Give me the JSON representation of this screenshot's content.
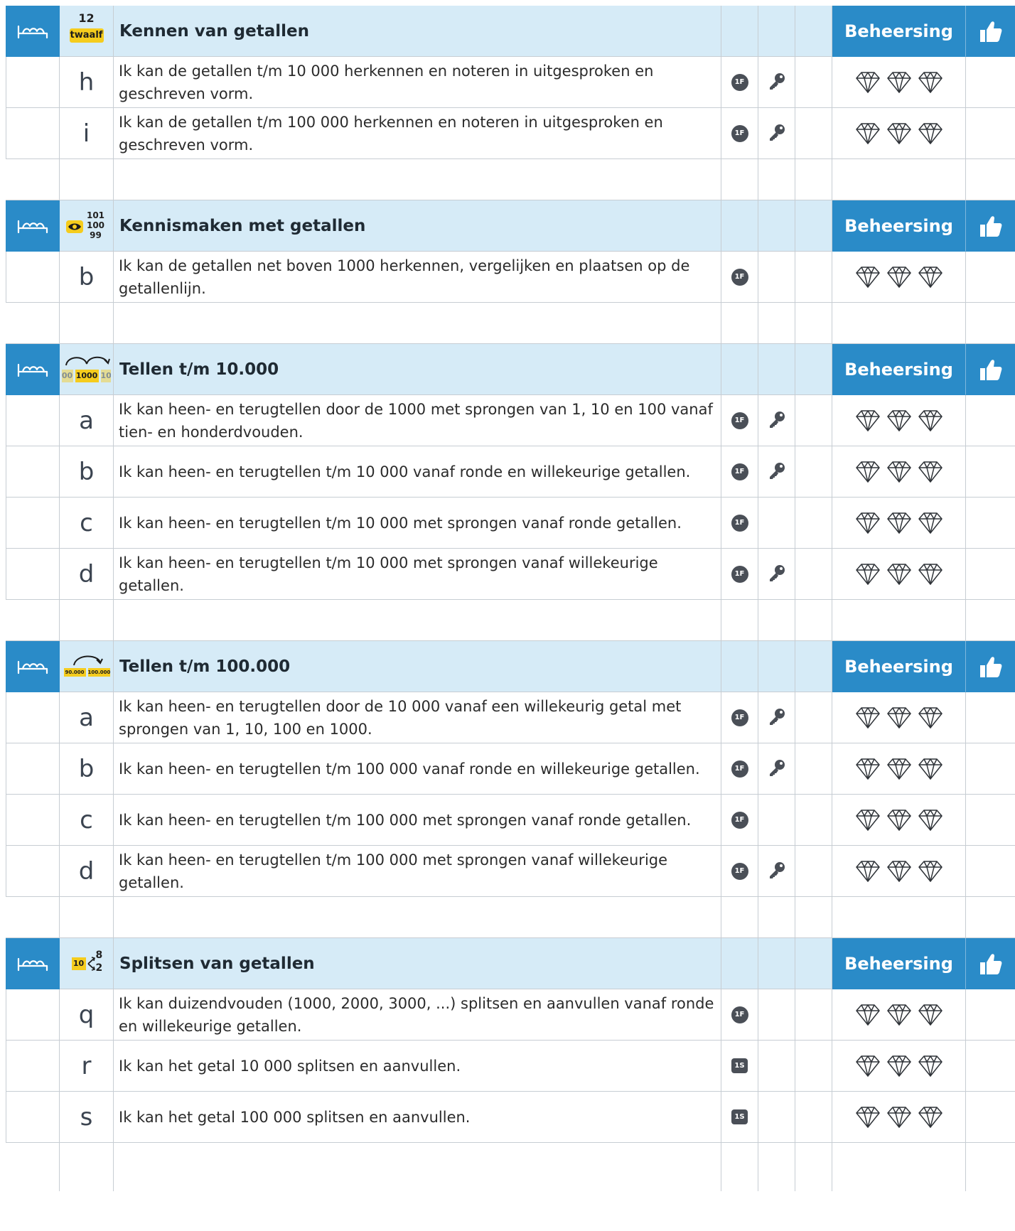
{
  "mastery_label": "Beheersing",
  "sections": [
    {
      "icon": "twaalf-icon",
      "icon_top": "12",
      "icon_bottom": "twaalf",
      "title": "Kennen van getallen",
      "items": [
        {
          "letter": "h",
          "text": "Ik kan de getallen t/m 10 000 herkennen en noteren in uitgesproken en geschreven vorm.",
          "badge": "1F",
          "key": true
        },
        {
          "letter": "i",
          "text": "Ik kan de getallen t/m 100 000 herkennen en noteren in uitgesproken en geschreven vorm.",
          "badge": "1F",
          "key": true
        }
      ]
    },
    {
      "icon": "eye-numbers-icon",
      "icon_numbers": [
        "101",
        "100",
        "99"
      ],
      "title": "Kennismaken met getallen",
      "items": [
        {
          "letter": "b",
          "text": "Ik kan de getallen net boven 1000 herkennen, vergelijken en plaatsen op de getallenlijn.",
          "badge": "1F",
          "key": false
        }
      ]
    },
    {
      "icon": "counting-jump-icon",
      "icon_labels": [
        "00",
        "1000",
        "10"
      ],
      "title": "Tellen t/m 10.000",
      "items": [
        {
          "letter": "a",
          "text": "Ik kan heen- en terugtellen door de 1000 met sprongen van 1, 10 en 100 vanaf tien- en honderdvouden.",
          "badge": "1F",
          "key": true
        },
        {
          "letter": "b",
          "text": "Ik kan heen- en terugtellen t/m 10 000 vanaf ronde en willekeurige getallen.",
          "badge": "1F",
          "key": true
        },
        {
          "letter": "c",
          "text": "Ik kan heen- en terugtellen t/m 10 000 met sprongen vanaf ronde getallen.",
          "badge": "1F",
          "key": false
        },
        {
          "letter": "d",
          "text": "Ik kan heen- en terugtellen t/m 10 000 met sprongen vanaf willekeurige getallen.",
          "badge": "1F",
          "key": true
        }
      ]
    },
    {
      "icon": "counting-jump-large-icon",
      "icon_labels": [
        "90.000",
        "100.000"
      ],
      "title": "Tellen t/m 100.000",
      "items": [
        {
          "letter": "a",
          "text": "Ik kan heen- en terugtellen door de 10 000 vanaf een willekeurig getal met sprongen van 1, 10, 100 en 1000.",
          "badge": "1F",
          "key": true
        },
        {
          "letter": "b",
          "text": "Ik kan heen- en terugtellen t/m 100 000 vanaf ronde en willekeurige getallen.",
          "badge": "1F",
          "key": true
        },
        {
          "letter": "c",
          "text": "Ik kan heen- en terugtellen t/m 100 000 met sprongen vanaf ronde getallen.",
          "badge": "1F",
          "key": false
        },
        {
          "letter": "d",
          "text": "Ik kan heen- en terugtellen t/m 100 000 met sprongen vanaf willekeurige getallen.",
          "badge": "1F",
          "key": true
        }
      ]
    },
    {
      "icon": "split-number-icon",
      "icon_labels": [
        "10",
        "8",
        "2"
      ],
      "title": "Splitsen van getallen",
      "items": [
        {
          "letter": "q",
          "text": "Ik kan duizendvouden (1000, 2000, 3000, ...) splitsen en aanvullen vanaf ronde en willekeurige getallen.",
          "badge": "1F",
          "key": false
        },
        {
          "letter": "r",
          "text": "Ik kan het getal 10 000 splitsen en aanvullen.",
          "badge": "1S",
          "key": false
        },
        {
          "letter": "s",
          "text": "Ik kan het getal 100 000 splitsen en aanvullen.",
          "badge": "1S",
          "key": false
        }
      ]
    }
  ],
  "colors": {
    "header_bg": "#d6ebf7",
    "accent": "#2a8bc8",
    "badge": "#4a4f57",
    "icon_yellow": "#f5cc1d"
  }
}
